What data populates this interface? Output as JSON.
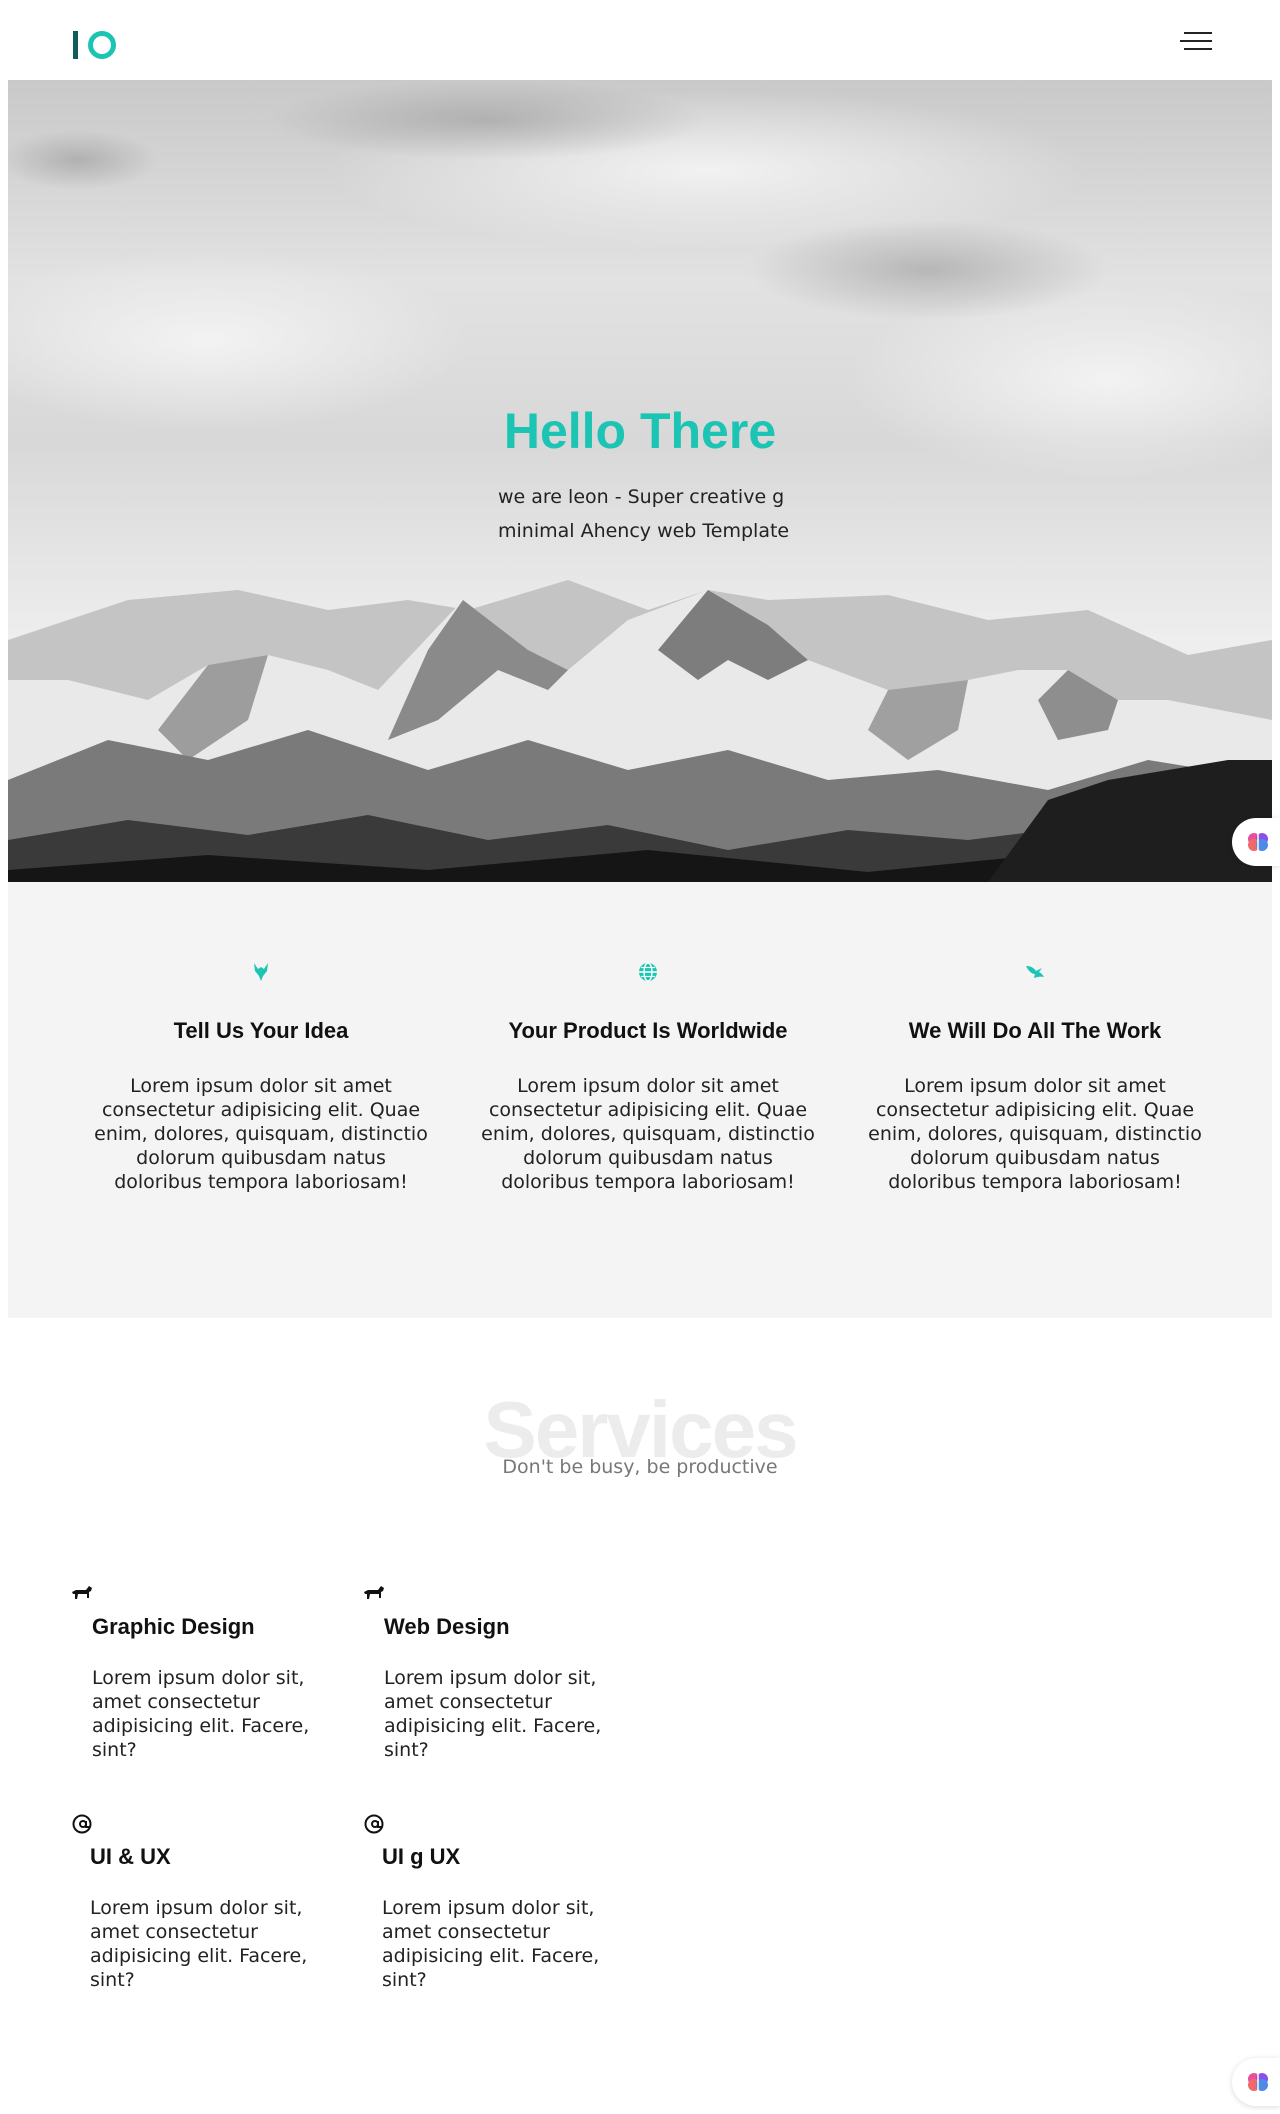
{
  "header": {
    "logo_alt": "IO",
    "menu_icon": "hamburger-menu-icon"
  },
  "hero": {
    "title": "Hello There",
    "subtitle": "we are leon - Super creative g minimal Ahency web Template"
  },
  "features": [
    {
      "icon": "wolf-icon",
      "title": "Tell Us Your Idea",
      "text": "Lorem ipsum dolor sit amet consectetur adipisicing elit. Quae enim, dolores, quisquam, distinctio dolorum quibusdam natus doloribus tempora laboriosam!"
    },
    {
      "icon": "globe-icon",
      "title": "Your Product Is Worldwide",
      "text": "Lorem ipsum dolor sit amet consectetur adipisicing elit. Quae enim, dolores, quisquam, distinctio dolorum quibusdam natus doloribus tempora laboriosam!"
    },
    {
      "icon": "bird-icon",
      "title": "We Will Do All The Work",
      "text": "Lorem ipsum dolor sit amet consectetur adipisicing elit. Quae enim, dolores, quisquam, distinctio dolorum quibusdam natus doloribus tempora laboriosam!"
    }
  ],
  "services": {
    "heading": "Services",
    "subheading": "Don't be busy, be productive",
    "items": [
      {
        "icon": "horse-icon",
        "title": "Graphic Design",
        "text": "Lorem ipsum dolor sit, amet consectetur adipisicing elit. Facere, sint?"
      },
      {
        "icon": "horse-icon",
        "title": "Web Design",
        "text": "Lorem ipsum dolor sit, amet consectetur adipisicing elit. Facere, sint?"
      },
      {
        "icon": "at-sign-icon",
        "title": "UI & UX",
        "text": "Lorem ipsum dolor sit, amet consectetur adipisicing elit. Facere, sint?"
      },
      {
        "icon": "at-sign-icon",
        "title": "UI g UX",
        "text": "Lorem ipsum dolor sit, amet consectetur adipisicing elit. Facere, sint?"
      }
    ]
  },
  "colors": {
    "accent": "#1cc4b4",
    "logo_dark": "#0f5d5a",
    "features_bg": "#f4f4f4"
  }
}
